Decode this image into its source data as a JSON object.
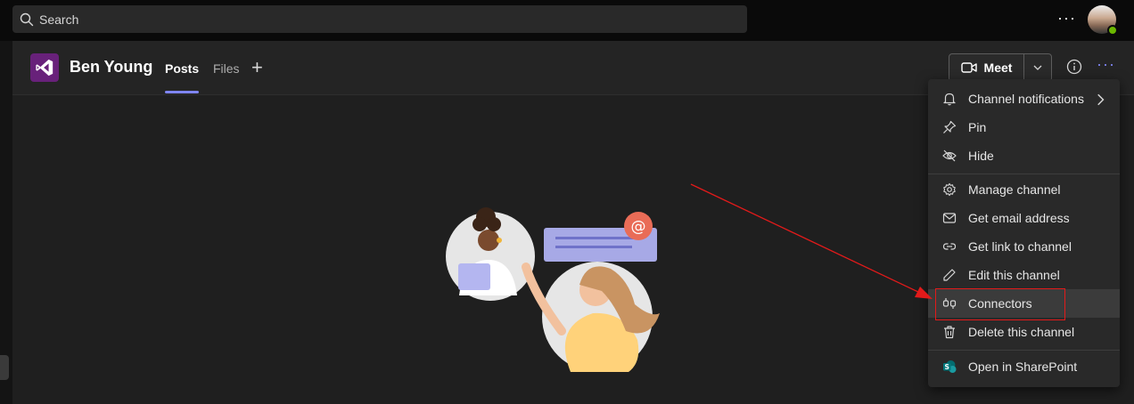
{
  "search": {
    "placeholder": "Search",
    "icon": "search-icon"
  },
  "topbar": {
    "more_label": "···",
    "avatar": "user-avatar",
    "presence_color": "#6bb700"
  },
  "header": {
    "team_name": "Ben Young",
    "tabs": [
      {
        "label": "Posts",
        "active": true
      },
      {
        "label": "Files",
        "active": false
      }
    ],
    "add_tab_label": "+",
    "meet_label": "Meet",
    "more_label": "···",
    "accent": "#7f85f5"
  },
  "menu": {
    "items": [
      {
        "label": "Channel notifications",
        "icon": "bell-icon",
        "has_submenu": true
      },
      {
        "label": "Pin",
        "icon": "pin-icon"
      },
      {
        "label": "Hide",
        "icon": "eye-off-icon"
      },
      {
        "label": "Manage channel",
        "icon": "gear-icon"
      },
      {
        "label": "Get email address",
        "icon": "mail-icon"
      },
      {
        "label": "Get link to channel",
        "icon": "link-icon"
      },
      {
        "label": "Edit this channel",
        "icon": "pencil-icon"
      },
      {
        "label": "Connectors",
        "icon": "plug-icon",
        "highlighted": true
      },
      {
        "label": "Delete this channel",
        "icon": "trash-icon"
      },
      {
        "label": "Open in SharePoint",
        "icon": "sharepoint-icon"
      }
    ]
  },
  "annotation": {
    "color": "#e21a1a"
  }
}
